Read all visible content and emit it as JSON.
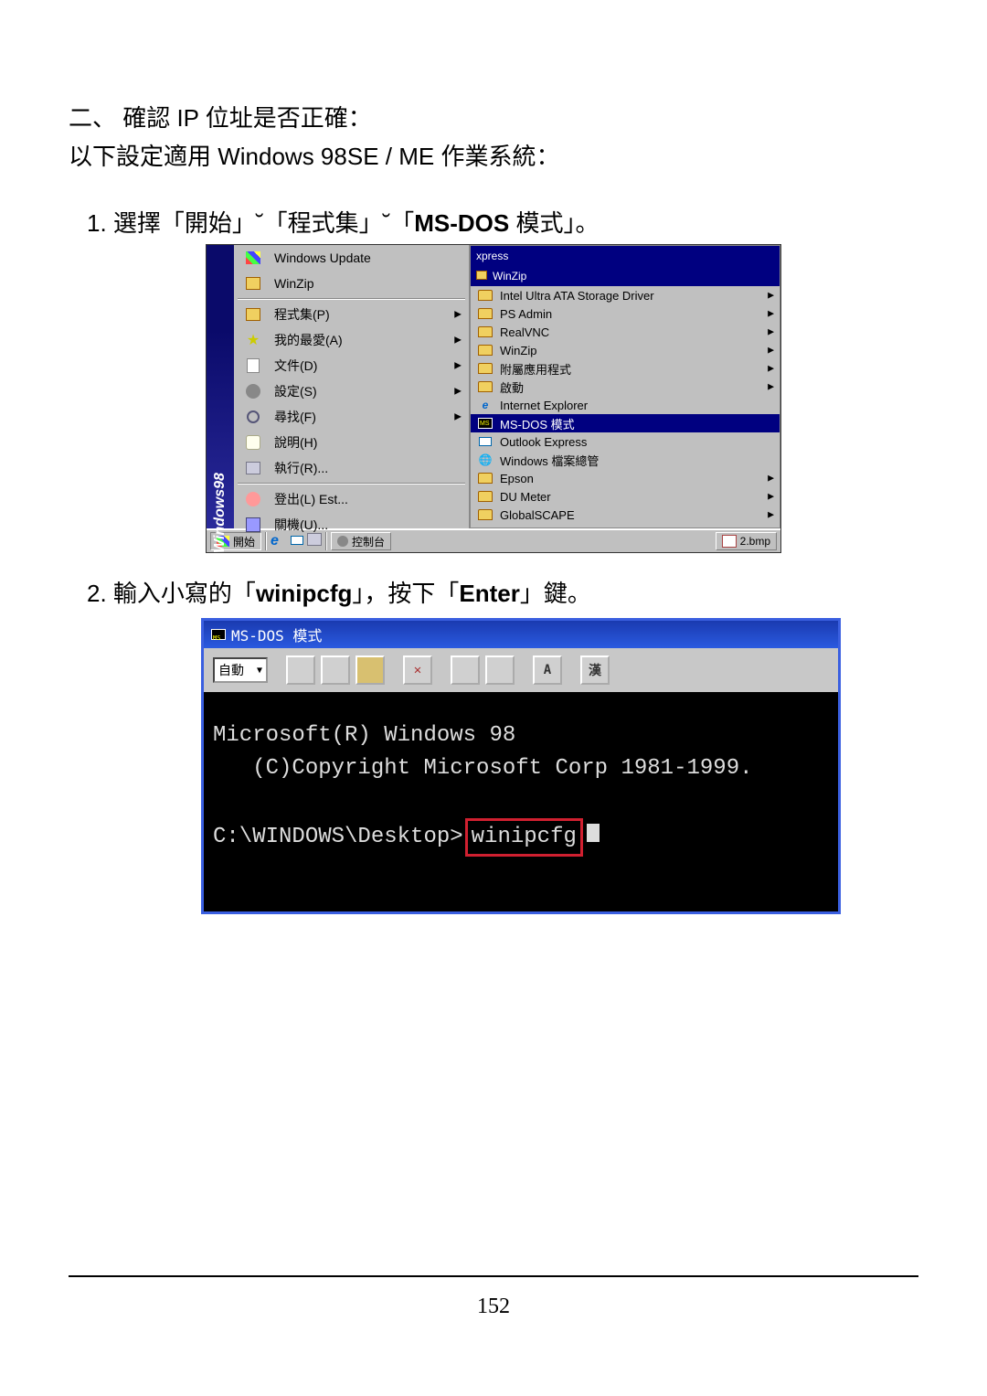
{
  "heading_prefix": "二、 確認 IP 位址是否正確：",
  "subheading_prefix": "以下設定適用 ",
  "subheading_bold": "Windows 98SE / ME",
  "subheading_suffix": " 作業系統：",
  "step1": {
    "num": "1.",
    "t1": "選擇「開始」˘「程式集」˘「",
    "bold": "MS-DOS",
    "t2": " 模式」。"
  },
  "step2": {
    "num": "2.",
    "t1": "輸入小寫的「",
    "bold1": "winipcfg",
    "t2": "」，按下「",
    "bold2": "Enter",
    "t3": "」鍵。"
  },
  "win98_label": "Windows98",
  "start_menu": {
    "top_items": [
      {
        "label": "Windows Update",
        "icon": "winflag"
      },
      {
        "label": "WinZip",
        "icon": "box"
      }
    ],
    "items": [
      {
        "label": "程式集(P)",
        "icon": "box",
        "arrow": true
      },
      {
        "label": "我的最愛(A)",
        "icon": "star",
        "arrow": true
      },
      {
        "label": "文件(D)",
        "icon": "doc",
        "arrow": true
      },
      {
        "label": "設定(S)",
        "icon": "gear",
        "arrow": true
      },
      {
        "label": "尋找(F)",
        "icon": "find",
        "arrow": true
      },
      {
        "label": "說明(H)",
        "icon": "help",
        "arrow": false
      },
      {
        "label": "執行(R)...",
        "icon": "run",
        "arrow": false
      }
    ],
    "bottom_items": [
      {
        "label": "登出(L) Est...",
        "icon": "logoff"
      },
      {
        "label": "關機(U)...",
        "icon": "shut"
      }
    ]
  },
  "submenu_header1": "xpress",
  "submenu_header2": "WinZip",
  "submenu_items": [
    {
      "label": "Intel Ultra ATA Storage Driver",
      "icon": "folder",
      "arrow": true
    },
    {
      "label": "PS Admin",
      "icon": "folder",
      "arrow": true
    },
    {
      "label": "RealVNC",
      "icon": "folder",
      "arrow": true
    },
    {
      "label": "WinZip",
      "icon": "folder",
      "arrow": true
    },
    {
      "label": "附屬應用程式",
      "icon": "folder",
      "arrow": true
    },
    {
      "label": "啟動",
      "icon": "folder",
      "arrow": true
    },
    {
      "label": "Internet Explorer",
      "icon": "ie",
      "arrow": false
    },
    {
      "label": "MS-DOS 模式",
      "icon": "dos",
      "arrow": false,
      "hi": true
    },
    {
      "label": "Outlook Express",
      "icon": "oe",
      "arrow": false
    },
    {
      "label": "Windows 檔案總管",
      "icon": "globe",
      "arrow": false
    },
    {
      "label": "Epson",
      "icon": "folder",
      "arrow": true
    },
    {
      "label": "DU Meter",
      "icon": "folder",
      "arrow": true
    },
    {
      "label": "GlobalSCAPE",
      "icon": "folder",
      "arrow": true
    }
  ],
  "taskbar": {
    "start": "開始",
    "task1": "控制台",
    "task2": "2.bmp"
  },
  "dos": {
    "title": "MS-DOS 模式",
    "dropdown": "自動",
    "han_btn": "漢",
    "a_btn": "A",
    "line1": "Microsoft(R) Windows 98",
    "line2": "   (C)Copyright Microsoft Corp 1981-1999.",
    "prompt": "C:\\WINDOWS\\Desktop>",
    "command": "winipcfg"
  },
  "page_number": "152"
}
